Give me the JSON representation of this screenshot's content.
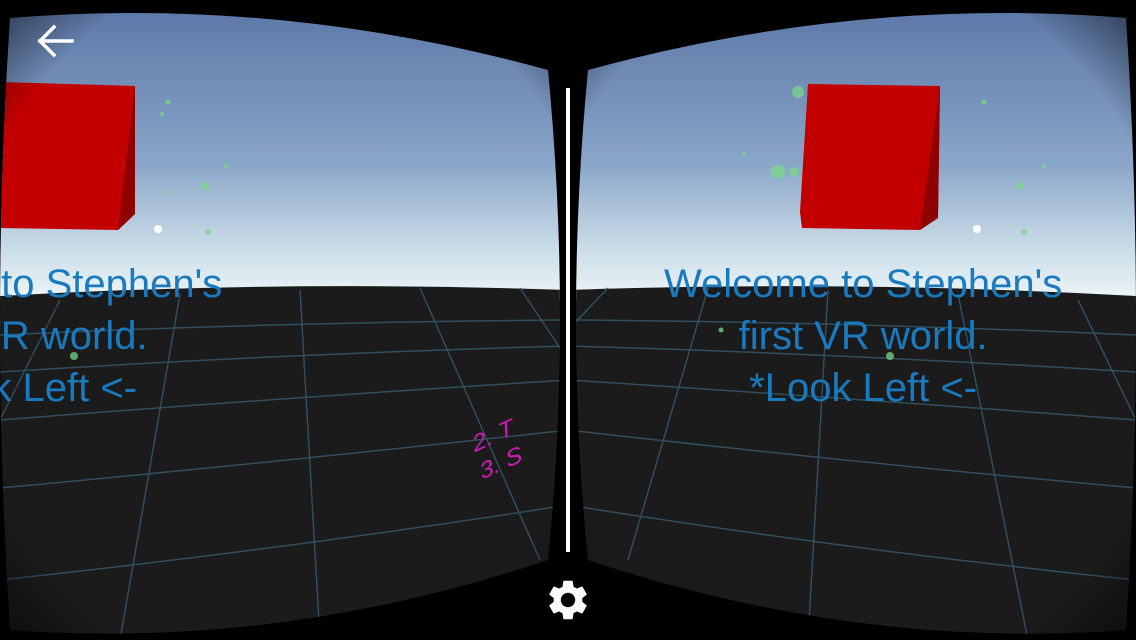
{
  "header": {
    "back_icon": "arrow-left-icon"
  },
  "scene": {
    "welcome_lines": [
      "Welcome to Stephen's",
      "first VR world.",
      "*Look Left <-"
    ],
    "partial_note_lines": [
      "2. T",
      "3. S"
    ],
    "colors": {
      "sky_top": "#5b78a8",
      "sky_horizon": "#e9f2f6",
      "ground": "#1a1a1a",
      "grid": "#2d4a5a",
      "cube": "#c00000",
      "text": "#1a7ac0",
      "note": "#d01ab8"
    }
  },
  "footer": {
    "settings_icon": "gear-icon"
  }
}
